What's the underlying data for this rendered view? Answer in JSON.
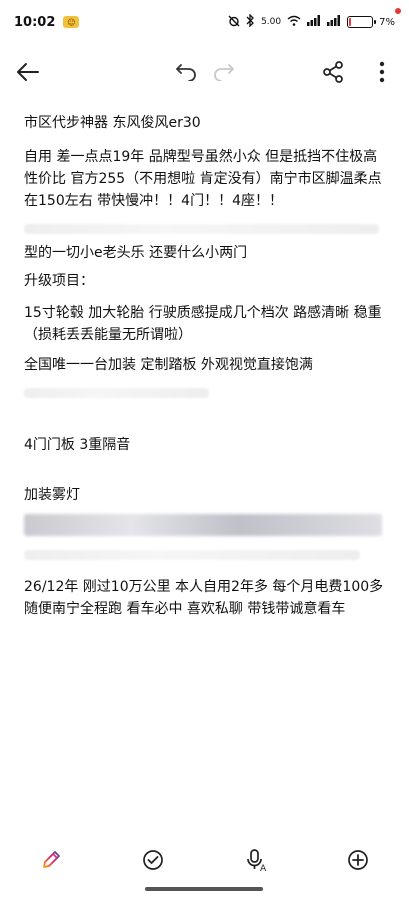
{
  "status_bar": {
    "time": "10:02",
    "app_badge": "😊",
    "network_speed": "5.00",
    "battery_percent": "7%",
    "battery_level": 0.07
  },
  "toolbar": {
    "icons": [
      "back-arrow-icon",
      "undo-icon",
      "redo-icon",
      "share-icon",
      "more-vertical-icon"
    ]
  },
  "note": {
    "lines": [
      "市区代步神器 东风俊风er30",
      "自用 差一点点19年 品牌型号虽然小众 但是抵挡不住极高性价比 官方255（不用想啦 肯定没有）南宁市区脚温柔点在150左右 带快慢冲！！4门！！4座！！",
      "型的一切小e老头乐 还要什么小两门",
      "升级项目：",
      "15寸轮毂 加大轮胎 行驶质感提成几个档次 路感清晰 稳重（损耗丢丢能量无所谓啦）",
      "全国唯一一台加装 定制踏板 外观视觉直接饱满",
      "4门门板 3重隔音",
      "加装雾灯",
      "26/12年 刚过10万公里 本人自用2年多 每个月电费100多 随便南宁全程跑 看车必中 喜欢私聊 带钱带诚意看车"
    ]
  },
  "bottom_bar": {
    "icons": [
      "pen-icon",
      "checklist-icon",
      "voice-input-icon",
      "add-icon"
    ]
  }
}
